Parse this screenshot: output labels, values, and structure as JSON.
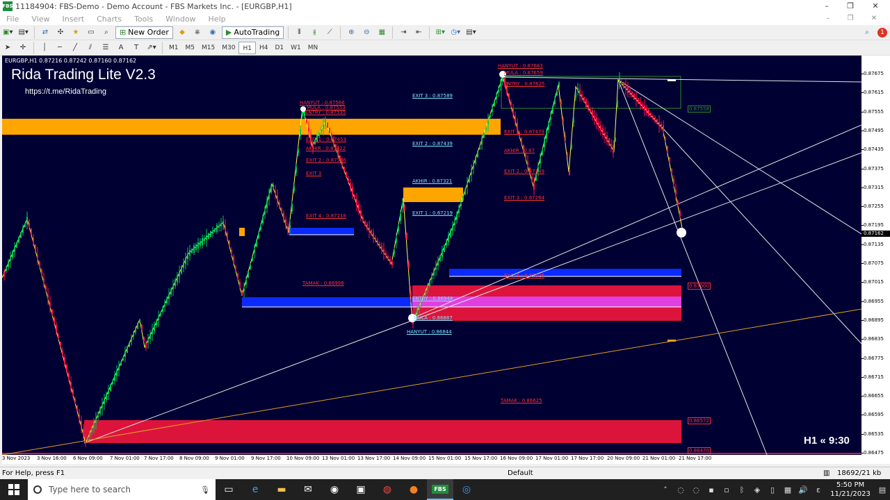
{
  "window": {
    "title": "11184904: FBS-Demo - Demo Account - FBS Markets Inc. - [EURGBP,H1]",
    "app_icon": "FBS"
  },
  "menu": [
    "File",
    "View",
    "Insert",
    "Charts",
    "Tools",
    "Window",
    "Help"
  ],
  "toolbar": {
    "new_order": "New Order",
    "autotrading": "AutoTrading",
    "timeframes": [
      "M1",
      "M5",
      "M15",
      "M30",
      "H1",
      "H4",
      "D1",
      "W1",
      "MN"
    ],
    "active_timeframe": "H1",
    "alert_count": "1"
  },
  "chart": {
    "symbol_info": "EURGBP,H1  0.87216 0.87242 0.87160 0.87162",
    "ea_title": "Rida Trading Lite V2.3",
    "ea_link": "https://t.me/RidaTrading",
    "tf_clock": "H1  « 9:30",
    "bg_color": "#000033",
    "levels_a": {
      "hanyut": "HANYUT : 0.87566",
      "mula": "MULA : 0.87553",
      "entry": "ENTRY : 0.87535",
      "exit1": "EXIT 1 : 0.87453",
      "akhir": "AKHIR : 0.87422",
      "exit2": "EXIT 2 : 0.87386",
      "exit3": "EXIT 3",
      "exit4": "EXIT 4 : 0.87218",
      "tamak": "TAMAK : 0.86998"
    },
    "levels_b": {
      "exit3": "EXIT 3 : 0.87589",
      "exit2": "EXIT 2 : 0.87439",
      "akhir": "AKHIR : 0.87321",
      "exit1": "EXIT 1 : 0.87219",
      "entry": "ENTRY : 0.86948",
      "mula": "MULA : 0.86887",
      "hanyut": "HANYUT : 0.86844"
    },
    "levels_c": {
      "hanyut": "HANYUT : 0.87683",
      "mula": "MULA : 0.87659",
      "entry": "ENTRY : 0.87625",
      "exit1": "EXIT 1 : 0.87473",
      "akhir": "AKHIR : 0.87",
      "exit2": "EXIT 2 : 0.87349",
      "exit3": "EXIT 3 : 0.87264",
      "exit4": "EXIT 4 : 0.87026",
      "tamak": "TAMAK : 0.86625"
    },
    "price_boxes": {
      "green": "0.87558",
      "red1": "0.87000",
      "red2": "0.86572",
      "red3": "0.86470"
    },
    "price_scale": [
      "0.87675",
      "0.87615",
      "0.87555",
      "0.87495",
      "0.87435",
      "0.87375",
      "0.87315",
      "0.87255",
      "0.87195",
      "0.87135",
      "0.87075",
      "0.87015",
      "0.86955",
      "0.86895",
      "0.86835",
      "0.86775",
      "0.86715",
      "0.86655",
      "0.86595",
      "0.86535",
      "0.86475"
    ],
    "current_price": "0.87162",
    "time_scale": [
      "3 Nov 2023",
      "3 Nov 16:00",
      "6 Nov 09:00",
      "7 Nov 01:00",
      "7 Nov 17:00",
      "8 Nov 09:00",
      "9 Nov 01:00",
      "9 Nov 17:00",
      "10 Nov 09:00",
      "13 Nov 01:00",
      "13 Nov 17:00",
      "14 Nov 09:00",
      "15 Nov 01:00",
      "15 Nov 17:00",
      "16 Nov 09:00",
      "17 Nov 01:00",
      "17 Nov 17:00",
      "20 Nov 09:00",
      "21 Nov 01:00",
      "21 Nov 17:00"
    ]
  },
  "status": {
    "help": "For Help, press F1",
    "profile": "Default",
    "traffic": "18692/21 kb"
  },
  "taskbar": {
    "search_placeholder": "Type here to search",
    "time": "5:50 PM",
    "date": "11/21/2023",
    "icons": [
      "task-view",
      "edge",
      "file-explorer",
      "mail",
      "podcast",
      "store",
      "chrome",
      "orange-app",
      "fbs",
      "other-app"
    ]
  }
}
